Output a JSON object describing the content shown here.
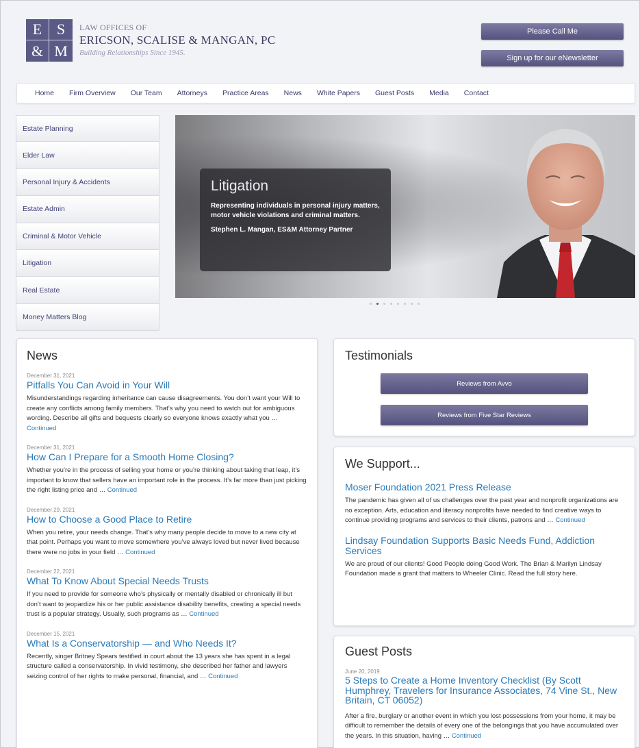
{
  "header": {
    "logo_letters": [
      "E",
      "S",
      "&",
      "M"
    ],
    "brand_prefix": "LAW OFFICES OF",
    "brand_name": "ERICSON, SCALISE & MANGAN, PC",
    "tagline": "Building Relationships Since 1945.",
    "call_button": "Please Call Me",
    "newsletter_button": "Sign up for our eNewsletter",
    "accent_color": "#5b5a86"
  },
  "nav": [
    "Home",
    "Firm Overview",
    "Our Team",
    "Attorneys",
    "Practice Areas",
    "News",
    "White Papers",
    "Guest Posts",
    "Media",
    "Contact"
  ],
  "sidebar": [
    "Estate Planning",
    "Elder Law",
    "Personal Injury & Accidents",
    "Estate Admin",
    "Criminal & Motor Vehicle",
    "Litigation",
    "Real Estate",
    "Money Matters Blog"
  ],
  "hero": {
    "title": "Litigation",
    "text": "Representing individuals in personal injury matters, motor vehicle violations and criminal matters.",
    "attorney_name": "Stephen L. Mangan",
    "attorney_role": ", ES&M Attorney Partner",
    "slide_count": 8,
    "active_slide": 2
  },
  "news": {
    "heading": "News",
    "continued": "Continued",
    "articles": [
      {
        "date": "December 31, 2021",
        "title": "Pitfalls You Can Avoid in Your Will",
        "body": "Misunderstandings regarding inheritance can cause disagreements. You don’t want your Will to create any conflicts among family members. That’s why you need to watch out for ambiguous wording. Describe all gifts and bequests clearly so everyone knows exactly what you … "
      },
      {
        "date": "December 31, 2021",
        "title": "How Can I Prepare for a Smooth Home Closing?",
        "body": "Whether you’re in the process of selling your home or you’re thinking about taking that leap, it’s important to know that sellers have an important role in the process. It’s far more than just picking the right listing price and … "
      },
      {
        "date": "December 29, 2021",
        "title": "How to Choose a Good Place to Retire",
        "body": "When you retire, your needs change. That’s why many people decide to move to a new city at that point. Perhaps you want to move somewhere you’ve always loved but never lived because there were no jobs in your field … "
      },
      {
        "date": "December 22, 2021",
        "title": "What To Know About Special Needs Trusts",
        "body": "If you need to provide for someone who’s physically or mentally disabled or chronically ill but don’t want to jeopardize his or her public assistance disability benefits, creating a special needs trust is a popular strategy. Usually, such programs as … "
      },
      {
        "date": "December 15, 2021",
        "title": "What Is a Conservatorship — and Who Needs It?",
        "body": "Recently, singer Britney Spears testified in court about the 13 years she has spent in a legal structure called a conservatorship. In vivid testimony, she described her father and lawyers seizing control of her rights to make personal, financial, and … "
      }
    ]
  },
  "testimonials": {
    "heading": "Testimonials",
    "avvo_button": "Reviews from Avvo",
    "fivestar_button": "Reviews from Five Star Reviews"
  },
  "support": {
    "heading": "We Support...",
    "continued": "Continued",
    "items": [
      {
        "title": "Moser Foundation 2021 Press Release",
        "body": "The pandemic has given all of us challenges over the past year and nonprofit organizations are no exception.  Arts, education and literacy nonprofits have needed to find creative ways to continue providing programs and services to their clients, patrons and … ",
        "has_more": true
      },
      {
        "title": "Lindsay Foundation Supports Basic Needs Fund, Addiction Services",
        "body": "We are proud of our clients! Good People doing Good Work. The Brian & Marilyn Lindsay Foundation made a grant that matters to Wheeler Clinic. Read the full story here.",
        "has_more": false
      }
    ]
  },
  "guest": {
    "heading": "Guest Posts",
    "date": "June 20, 2019",
    "title": "5 Steps to Create a Home Inventory Checklist (By Scott Humphrey, Travelers for Insurance Associates, 74 Vine St., New Britain, CT 06052)",
    "body": "After a fire, burglary or another event in which you lost possessions from your home, it may be difficult to remember the details of every one of the belongings that you have accumulated over the years. In this situation, having … ",
    "continued": "Continued"
  }
}
